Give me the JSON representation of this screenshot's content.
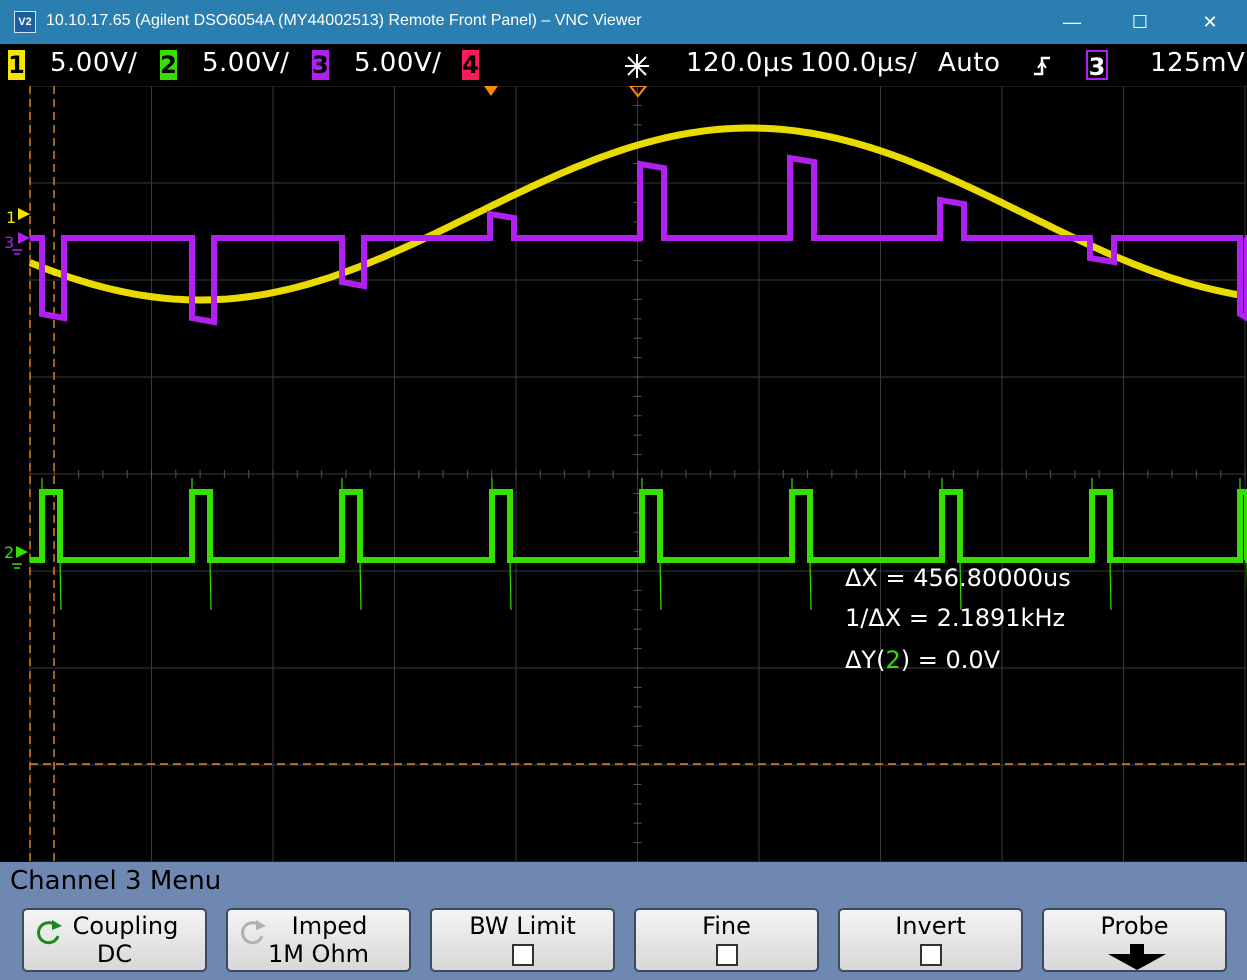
{
  "window": {
    "app_icon": "V2",
    "title": "10.10.17.65 (Agilent DSO6054A (MY44002513) Remote Front Panel) – VNC Viewer",
    "controls": [
      "—",
      "☐",
      "✕"
    ]
  },
  "status": {
    "channels": [
      {
        "num": "1",
        "scale": "5.00V/",
        "color": "#f5e600"
      },
      {
        "num": "2",
        "scale": "5.00V/",
        "color": "#33e000"
      },
      {
        "num": "3",
        "scale": "5.00V/",
        "color": "#b020f0"
      },
      {
        "num": "4",
        "scale": "",
        "color": "#ff1a5a"
      }
    ],
    "run_icon": "acquire-snowflake-icon",
    "time_delay": "120.0µs",
    "time_base": "100.0µs/",
    "trigger_mode": "Auto",
    "trigger_slope_icon": "rising-edge-icon",
    "trigger_source": "3",
    "trigger_level": "125mV"
  },
  "measurements": {
    "dx": "ΔX = 456.80000us",
    "inv_dx": "1/ΔX = 2.1891kHz",
    "dy_prefix": "ΔY(",
    "dy_channel": "2",
    "dy_suffix": ") = 0.0V"
  },
  "markers": {
    "ch1": "1",
    "ch3": "3",
    "ch2": "2"
  },
  "colors": {
    "ch1": "#f5e600",
    "ch2": "#33e000",
    "ch3": "#b020f0",
    "cursor": "#e08020",
    "trigger_marker": "#ff8800",
    "menu_bg": "#6f88b1"
  },
  "menu": {
    "title": "Channel 3  Menu",
    "softkeys": [
      {
        "label": "Coupling",
        "value": "DC",
        "icon": "rotate-arrow-icon"
      },
      {
        "label": "Imped",
        "value": "1M Ohm",
        "icon": "rotate-arrow-icon"
      },
      {
        "label": "BW Limit",
        "value": "",
        "icon": "checkbox-icon"
      },
      {
        "label": "Fine",
        "value": "",
        "icon": "checkbox-icon"
      },
      {
        "label": "Invert",
        "value": "",
        "icon": "checkbox-icon"
      },
      {
        "label": "Probe",
        "value": "",
        "icon": "down-arrow-icon"
      }
    ]
  }
}
